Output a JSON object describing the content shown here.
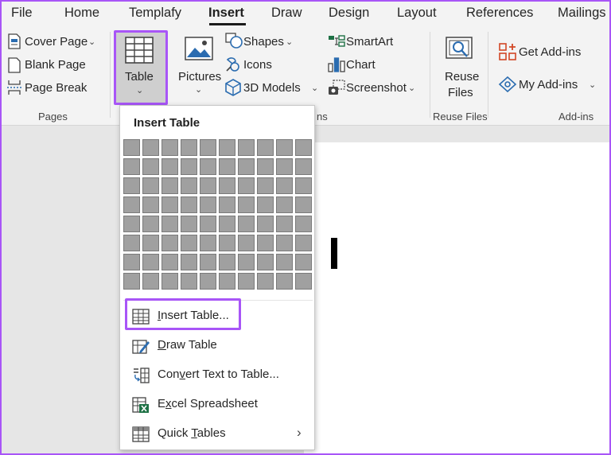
{
  "tabs": [
    "File",
    "Home",
    "Templafy",
    "Insert",
    "Draw",
    "Design",
    "Layout",
    "References",
    "Mailings"
  ],
  "active_tab": "Insert",
  "ribbon": {
    "pages": {
      "cover_page": "Cover Page",
      "blank_page": "Blank Page",
      "page_break": "Page Break",
      "group_label": "Pages"
    },
    "table": {
      "label": "Table"
    },
    "illustrations": {
      "pictures": "Pictures",
      "shapes": "Shapes",
      "icons": "Icons",
      "models_3d": "3D Models",
      "smartart": "SmartArt",
      "chart": "Chart",
      "screenshot": "Screenshot",
      "group_label_partial": "ns"
    },
    "reuse": {
      "label_line1": "Reuse",
      "label_line2": "Files",
      "group_label": "Reuse Files"
    },
    "addins": {
      "get_addins": "Get Add-ins",
      "my_addins": "My Add-ins",
      "group_label": "Add-ins"
    }
  },
  "table_menu": {
    "title": "Insert Table",
    "grid_cols": 10,
    "grid_rows": 8,
    "items": [
      {
        "pre": "",
        "acc": "I",
        "post": "nsert Table...",
        "icon": "table-grid-icon"
      },
      {
        "pre": "",
        "acc": "D",
        "post": "raw Table",
        "icon": "draw-table-pencil-icon"
      },
      {
        "pre": "Con",
        "acc": "v",
        "post": "ert Text to Table...",
        "icon": "convert-text-table-icon"
      },
      {
        "pre": "E",
        "acc": "x",
        "post": "cel Spreadsheet",
        "icon": "excel-spreadsheet-icon"
      },
      {
        "pre": "Quick ",
        "acc": "T",
        "post": "ables",
        "icon": "quick-tables-icon",
        "has_submenu": true
      }
    ]
  },
  "colors": {
    "highlight": "#a855f7",
    "ribbon_bg": "#f3f3f3",
    "canvas_bg": "#e6e6e6",
    "grid_cell": "#a0a0a0",
    "excel_green": "#1e7145",
    "icon_blue": "#2b6cb0",
    "addin_orange": "#d24726"
  }
}
